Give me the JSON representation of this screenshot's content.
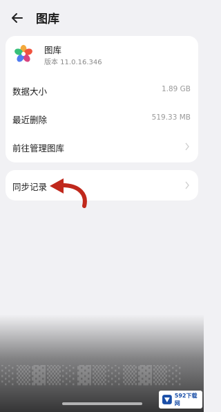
{
  "header": {
    "title": "图库"
  },
  "app": {
    "name": "图库",
    "version": "版本 11.0.16.346"
  },
  "storage": {
    "data_size_label": "数据大小",
    "data_size_value": "1.89 GB",
    "recently_deleted_label": "最近删除",
    "recently_deleted_value": "519.33 MB",
    "manage_label": "前往管理图库"
  },
  "sync": {
    "label": "同步记录"
  },
  "colors": {
    "background": "#f1f1f4",
    "card": "#ffffff",
    "annotation_arrow": "#c0281c"
  },
  "watermark": {
    "text": "592下载网"
  }
}
